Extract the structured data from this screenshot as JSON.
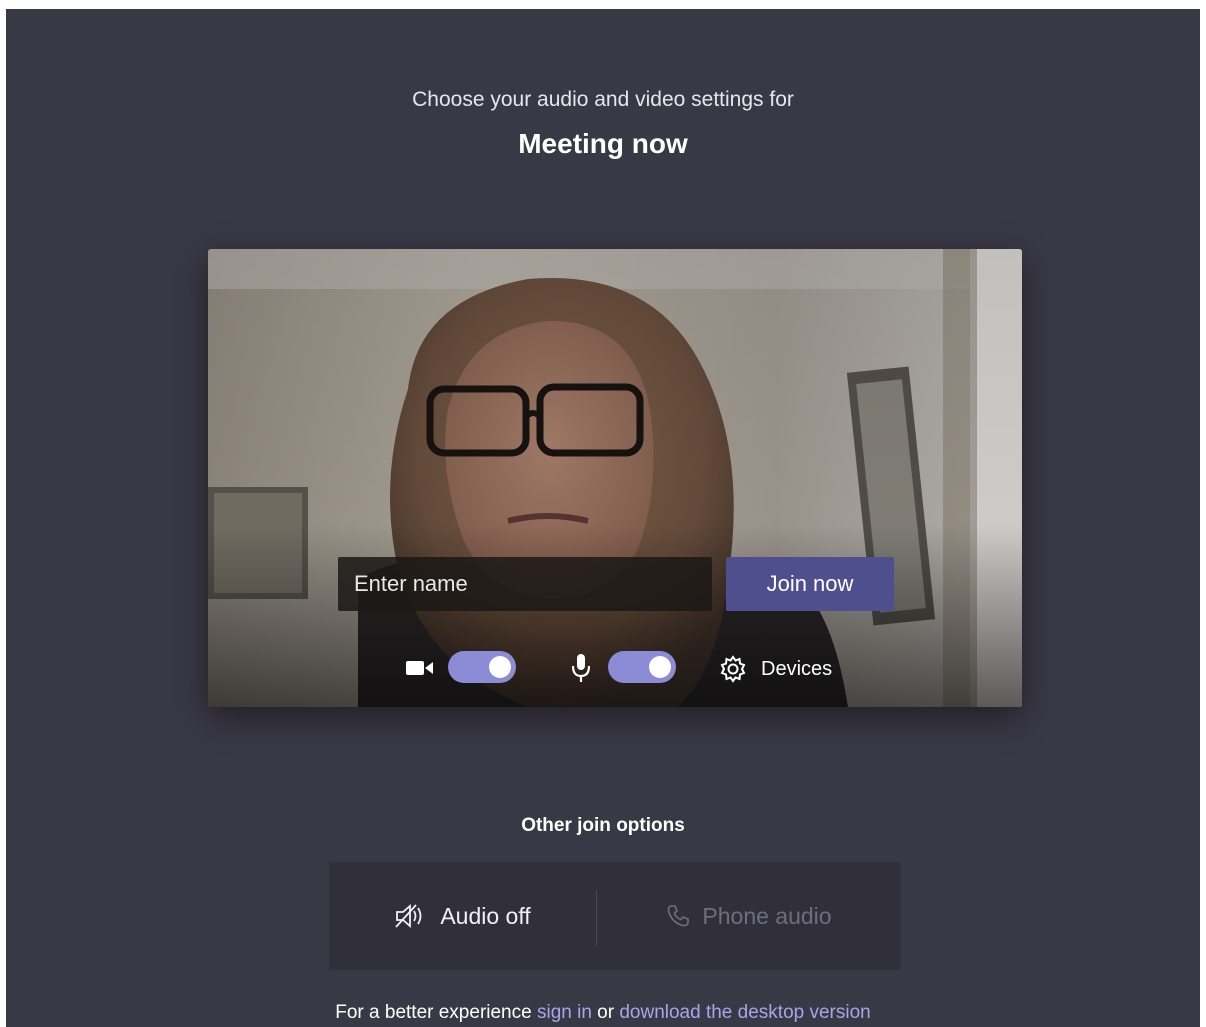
{
  "header": {
    "subtitle": "Choose your audio and video settings for",
    "title": "Meeting now"
  },
  "preview": {
    "name_placeholder": "Enter name",
    "join_label": "Join now",
    "video_enabled": true,
    "audio_enabled": true,
    "devices_label": "Devices"
  },
  "other_options": {
    "title": "Other join options",
    "audio_off_label": "Audio off",
    "phone_audio_label": "Phone audio",
    "phone_audio_disabled": true
  },
  "footer": {
    "prefix": "For a better experience ",
    "sign_in": "sign in",
    "middle": " or ",
    "download": "download the desktop version"
  },
  "colors": {
    "background": "#393845",
    "primary_button": "#4f4f8e",
    "toggle_on": "#8b8bd6",
    "link": "#a6a6e8"
  },
  "icons": [
    "video-camera-icon",
    "microphone-icon",
    "gear-icon",
    "speaker-off-icon",
    "phone-icon"
  ]
}
